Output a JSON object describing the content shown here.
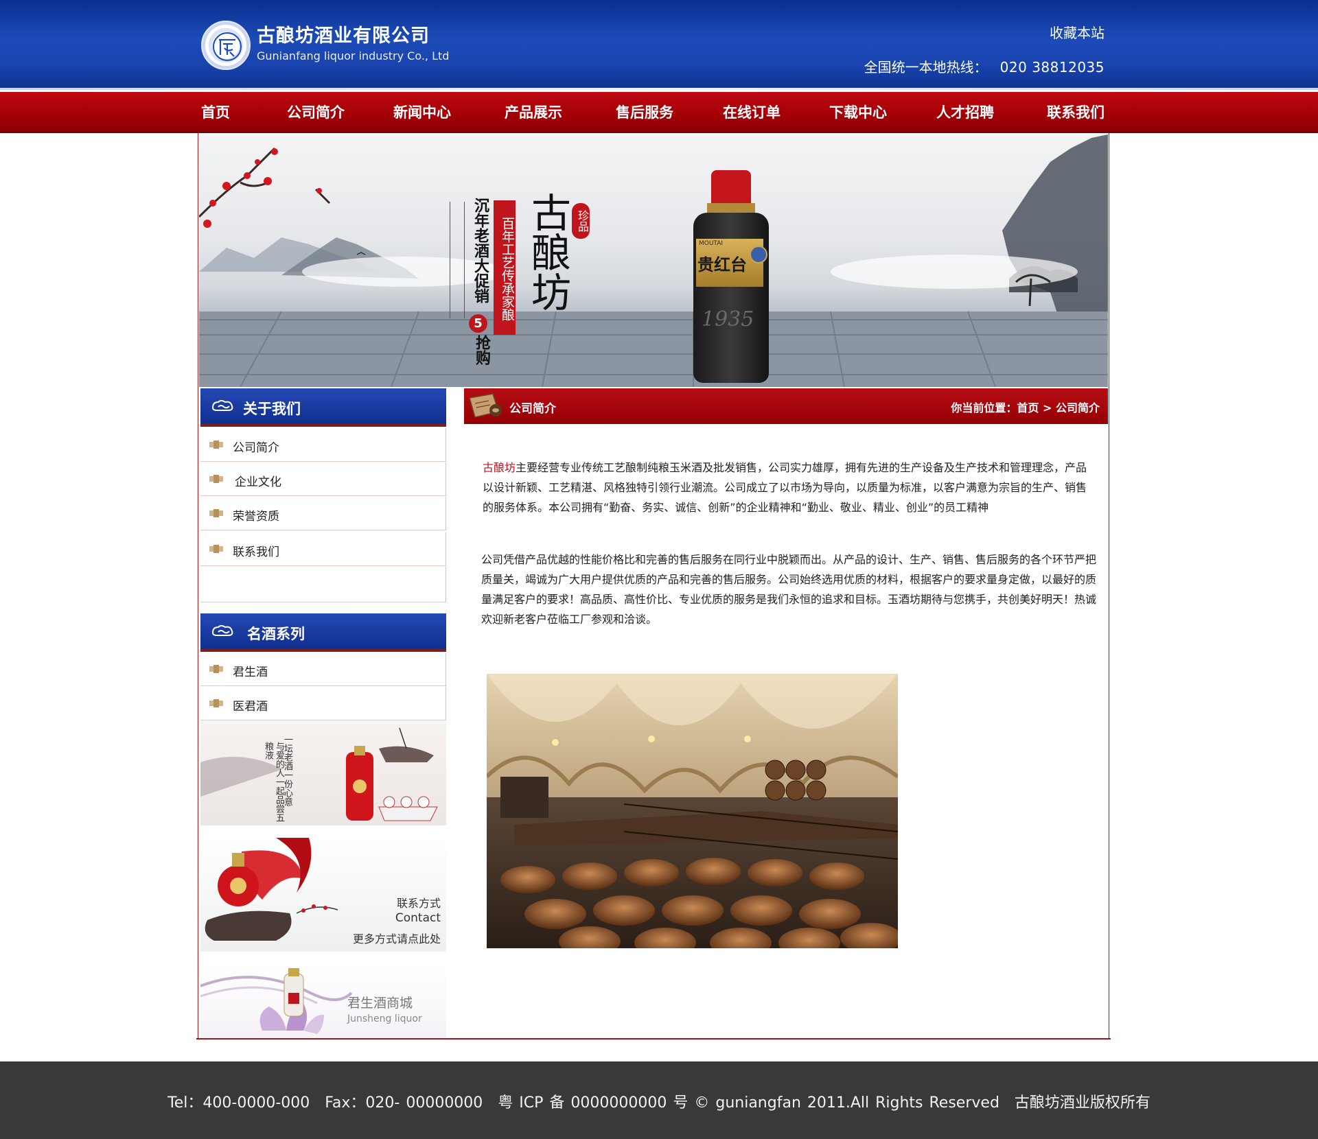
{
  "header": {
    "company_cn": "古酿坊酒业有限公司",
    "company_en": "Gunianfang liquor industry Co., Ltd",
    "favorite": "收藏本站",
    "hotline_label": "全国统一本地热线：",
    "hotline_number": "020 38812035"
  },
  "nav": {
    "items": [
      "首页",
      "公司简介",
      "新闻中心",
      "产品展示",
      "售后服务",
      "在线订单",
      "下载中心",
      "人才招聘",
      "联系我们"
    ]
  },
  "banner": {
    "brand": "古酿坊",
    "seal": "珍品",
    "slogan_red": "百年工艺传承家酿",
    "slogan_black": "沉年老酒大促销",
    "promo_num": "5",
    "promo_tail": "抢购",
    "bottle_label": "贵红台",
    "bottle_brand": "MOUTAI",
    "bottle_year": "1935"
  },
  "sidebar": {
    "about_title": "关于我们",
    "about_items": [
      "公司简介",
      "企业文化",
      "荣誉资质",
      "联系我们"
    ],
    "series_title": "名酒系列",
    "series_items": [
      "君生酒",
      "医君酒"
    ],
    "promo1": {
      "line1": "一坛老酒一份心意",
      "line2": "与爱的人一起品尝五粮液"
    },
    "promo2": {
      "line1": "联系方式",
      "line2": "Contact",
      "line3": "更多方式请点此处"
    },
    "promo3": {
      "line1": "君生酒商城",
      "line2": "Junsheng liquor"
    }
  },
  "content": {
    "title": "公司简介",
    "crumb_label": "你当前位置：",
    "crumb_home": "首页",
    "crumb_sep": ">",
    "crumb_current": "公司简介",
    "p1_brand": "古酿坊",
    "p1_rest": "主要经营专业传统工艺酿制纯粮玉米酒及批发销售，公司实力雄厚，拥有先进的生产设备及生产技术和管理理念，产品以设计新颖、工艺精湛、风格独特引领行业潮流。公司成立了以市场为导向，以质量为标准，以客户满意为宗旨的生产、销售的服务体系。本公司拥有“勤奋、务实、诚信、创新”的企业精神和“勤业、敬业、精业、创业”的员工精神",
    "p2": "公司凭借产品优越的性能价格比和完善的售后服务在同行业中脱颖而出。从产品的设计、生产、销售、售后服务的各个环节严把质量关，竭诚为广大用户提供优质的产品和完善的售后服务。公司始终选用优质的材料，根据客户的要求量身定做，以最好的质量满足客户的要求！高品质、高性价比、专业优质的服务是我们永恒的追求和目标。玉酒坊期待与您携手，共创美好明天！热诚欢迎新老客户莅临工厂参观和洽谈。"
  },
  "footer": {
    "tel": "Tel：400-0000-000",
    "fax": "Fax：020- 00000000",
    "icp": "粤 ICP 备 0000000000 号 © guniangfan 2011.All Rights Reserved",
    "copyright": "古酿坊酒业版权所有"
  },
  "colors": {
    "header_blue": "#1a45b0",
    "nav_red": "#a40006",
    "accent_red": "#c0151c",
    "footer_gray": "#393939"
  }
}
